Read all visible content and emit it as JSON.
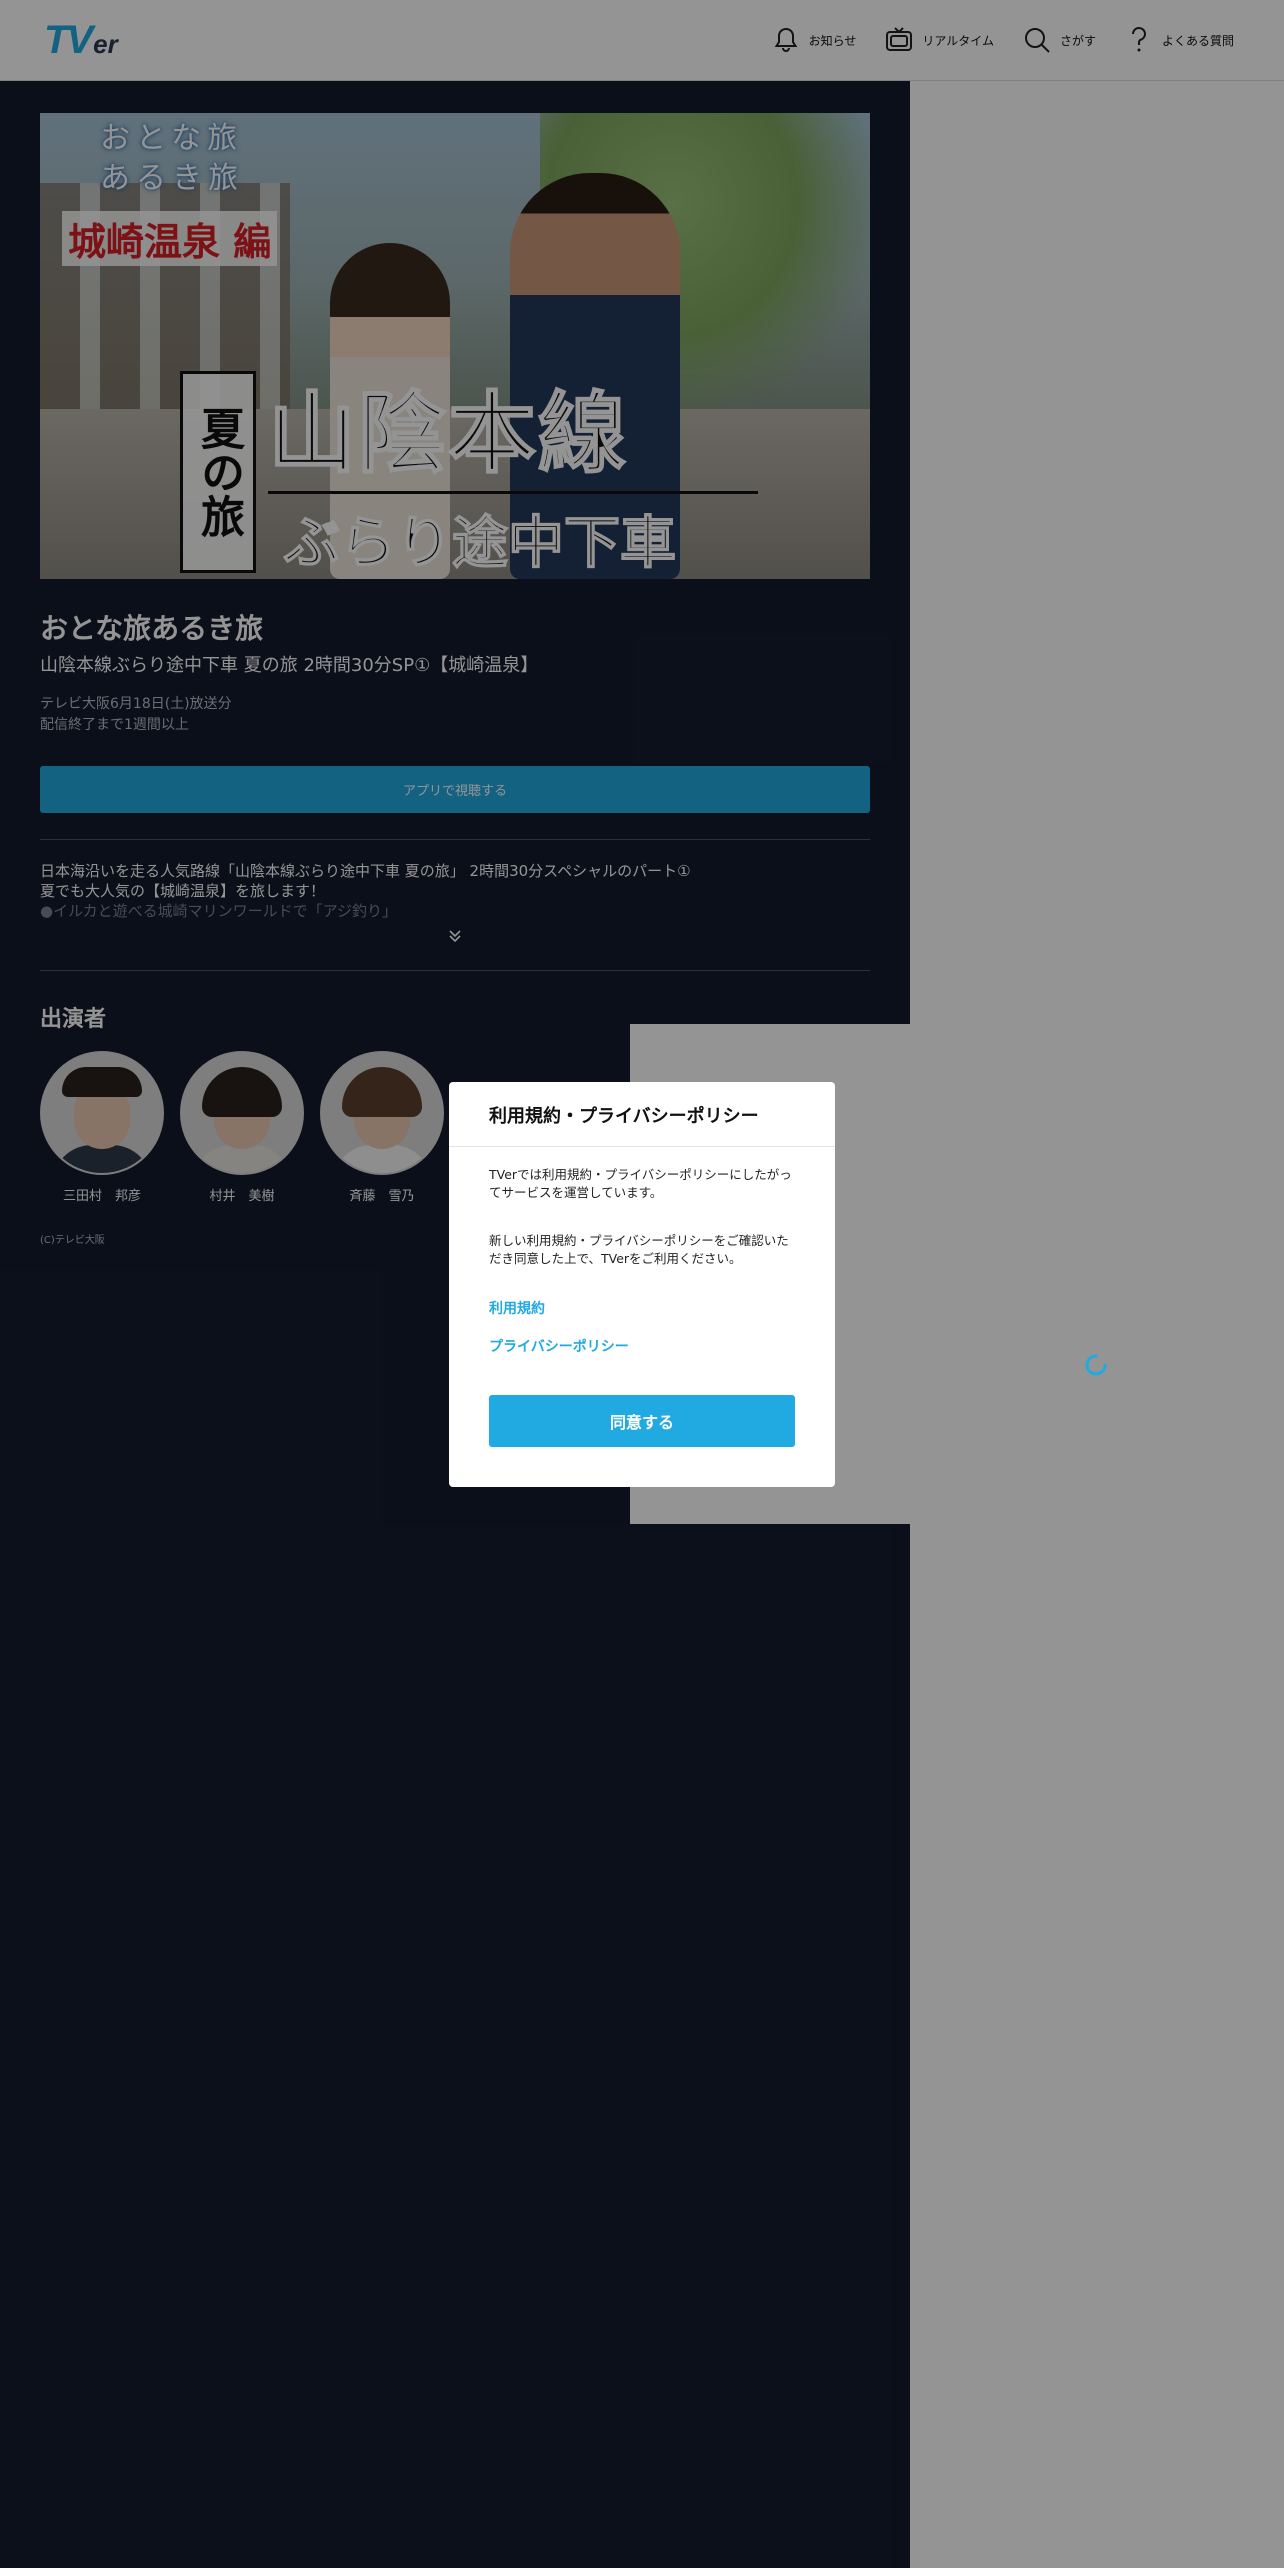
{
  "header": {
    "logo": {
      "t": "T",
      "v": "V",
      "er": "er"
    },
    "nav": [
      {
        "label": "お知らせ",
        "icon": "bell-icon"
      },
      {
        "label": "リアルタイム",
        "icon": "tv-icon"
      },
      {
        "label": "さがす",
        "icon": "search-icon"
      },
      {
        "label": "よくある質問",
        "icon": "question-icon"
      }
    ]
  },
  "hero": {
    "line1": "おとな旅",
    "line2": "あるき旅",
    "subtitle": "城崎温泉 編",
    "boxed": "夏の旅",
    "big": "山陰本線",
    "small": "ぶらり途中下車"
  },
  "episode": {
    "series_title": "おとな旅あるき旅",
    "title": "山陰本線ぶらり途中下車 夏の旅 2時間30分SP①【城崎温泉】",
    "broadcast": "テレビ大阪6月18日(土)放送分",
    "availability": "配信終了まで1週間以上",
    "watch_button": "アプリで視聴する",
    "description_line1": "日本海沿いを走る人気路線「山陰本線ぶらり途中下車 夏の旅」 2時間30分スペシャルのパート①",
    "description_line2": "夏でも大人気の【城崎温泉】を旅します！",
    "description_line3": "●イルカと遊べる城崎マリンワールドで「アジ釣り」"
  },
  "cast": {
    "heading": "出演者",
    "members": [
      {
        "name": "三田村　邦彦"
      },
      {
        "name": "村井　美樹"
      },
      {
        "name": "斉藤　雪乃"
      }
    ]
  },
  "copyright": "(C)テレビ大阪",
  "modal": {
    "title": "利用規約・プライバシーポリシー",
    "paragraph1": "TVerでは利用規約・プライバシーポリシーにしたがってサービスを運営しています。",
    "paragraph2": "新しい利用規約・プライバシーポリシーをご確認いただき同意した上で、TVerをご利用ください。",
    "link_terms": "利用規約",
    "link_privacy": "プライバシーポリシー",
    "agree_button": "同意する"
  },
  "colors": {
    "accent": "#21a9e1",
    "dark_bg": "#141b2d",
    "overlay": "rgba(0,0,0,0.42)"
  }
}
